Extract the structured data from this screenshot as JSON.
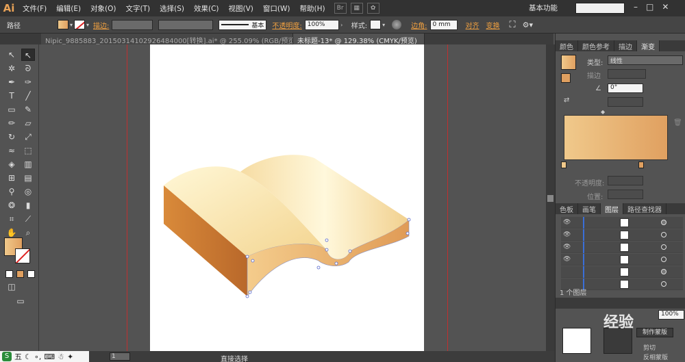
{
  "app": {
    "logo": "Ai"
  },
  "menu": [
    "文件(F)",
    "编辑(E)",
    "对象(O)",
    "文字(T)",
    "选择(S)",
    "效果(C)",
    "视图(V)",
    "窗口(W)",
    "帮助(H)"
  ],
  "workspace": "基本功能",
  "control": {
    "selection_label": "路径",
    "stroke_label": "描边:",
    "stroke_style": "基本",
    "opacity_label": "不透明度:",
    "opacity_value": "100%",
    "style_label": "样式:",
    "corner_label": "边角:",
    "corner_value": "0 mm",
    "align_label": "对齐",
    "transform_label": "变换"
  },
  "tabs": [
    {
      "label": "Nipic_9885883_20150314102926484000[转换].ai* @ 255.09% (RGB/预览)",
      "active": false
    },
    {
      "label": "未标题-13* @ 129.38% (CMYK/预览)",
      "active": true
    }
  ],
  "panel": {
    "top_tabs": [
      "颜色",
      "颜色参考",
      "描边",
      "渐变"
    ],
    "type_label": "类型:",
    "type_value": "线性",
    "stroke_label": "描边",
    "angle_value": "0°",
    "opacity_label": "不透明度:",
    "position_label": "位置:",
    "layer_tabs": [
      "色板",
      "画笔",
      "图层",
      "路径查找器"
    ],
    "layer_count": "1 个图层",
    "opacity_bottom": "100%",
    "make_mask": "制作蒙版",
    "clip_label": "剪切",
    "invert_mask": "反相蒙版"
  },
  "status": {
    "tool": "直接选择",
    "page": "1"
  },
  "taskbar": {
    "label": "五"
  },
  "watermark": "经验",
  "colors": {
    "accent": "#f0a040",
    "gradient_start": "#f0c98b",
    "gradient_end": "#e0a060"
  }
}
